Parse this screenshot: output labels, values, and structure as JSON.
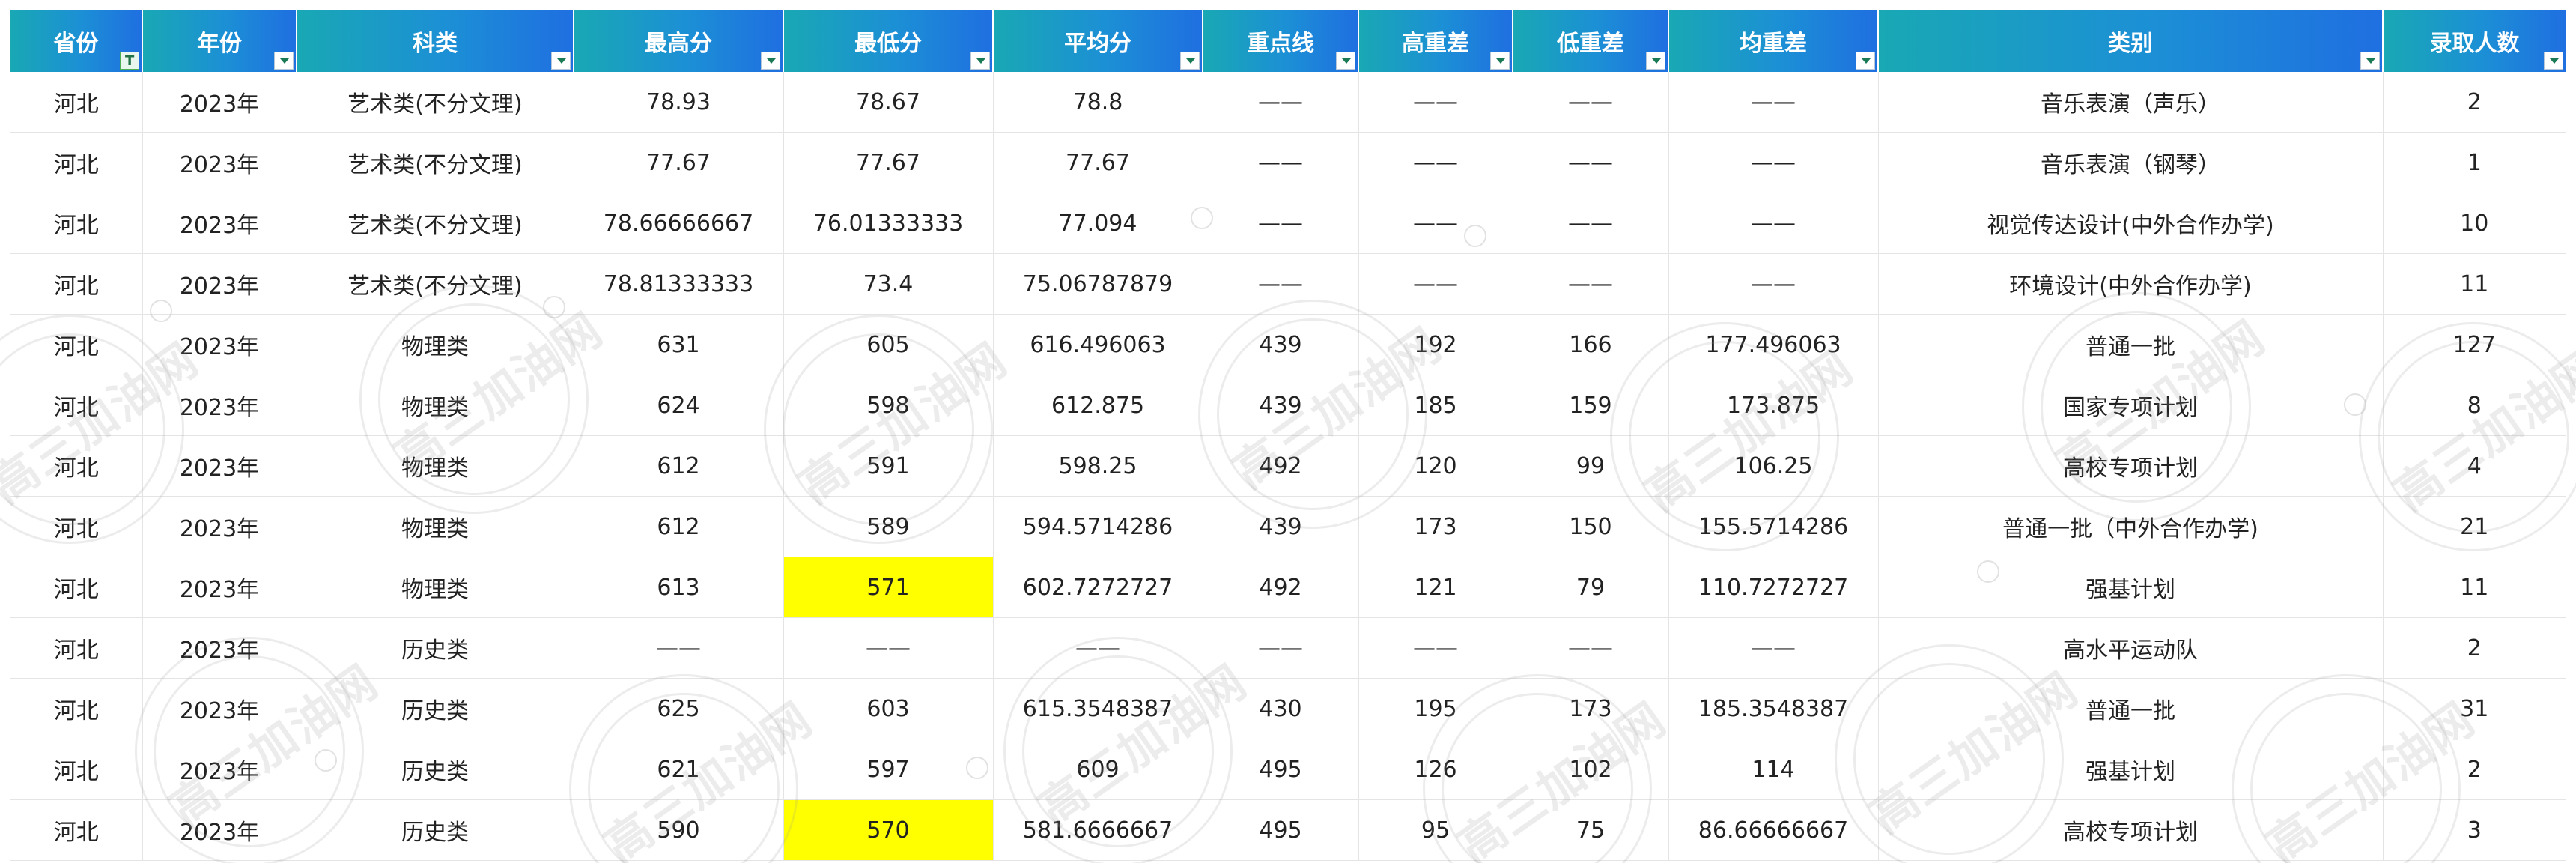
{
  "table": {
    "headers": [
      "省份",
      "年份",
      "科类",
      "最高分",
      "最低分",
      "平均分",
      "重点线",
      "高重差",
      "低重差",
      "均重差",
      "类别",
      "录取人数"
    ],
    "rows": [
      [
        "河北",
        "2023年",
        "艺术类(不分文理)",
        "78.93",
        "78.67",
        "78.8",
        "——",
        "——",
        "——",
        "——",
        "音乐表演（声乐）",
        "2"
      ],
      [
        "河北",
        "2023年",
        "艺术类(不分文理)",
        "77.67",
        "77.67",
        "77.67",
        "——",
        "——",
        "——",
        "——",
        "音乐表演（钢琴）",
        "1"
      ],
      [
        "河北",
        "2023年",
        "艺术类(不分文理)",
        "78.66666667",
        "76.01333333",
        "77.094",
        "——",
        "——",
        "——",
        "——",
        "视觉传达设计(中外合作办学)",
        "10"
      ],
      [
        "河北",
        "2023年",
        "艺术类(不分文理)",
        "78.81333333",
        "73.4",
        "75.06787879",
        "——",
        "——",
        "——",
        "——",
        "环境设计(中外合作办学)",
        "11"
      ],
      [
        "河北",
        "2023年",
        "物理类",
        "631",
        "605",
        "616.496063",
        "439",
        "192",
        "166",
        "177.496063",
        "普通一批",
        "127"
      ],
      [
        "河北",
        "2023年",
        "物理类",
        "624",
        "598",
        "612.875",
        "439",
        "185",
        "159",
        "173.875",
        "国家专项计划",
        "8"
      ],
      [
        "河北",
        "2023年",
        "物理类",
        "612",
        "591",
        "598.25",
        "492",
        "120",
        "99",
        "106.25",
        "高校专项计划",
        "4"
      ],
      [
        "河北",
        "2023年",
        "物理类",
        "612",
        "589",
        "594.5714286",
        "439",
        "173",
        "150",
        "155.5714286",
        "普通一批（中外合作办学)",
        "21"
      ],
      [
        "河北",
        "2023年",
        "物理类",
        "613",
        "571",
        "602.7272727",
        "492",
        "121",
        "79",
        "110.7272727",
        "强基计划",
        "11"
      ],
      [
        "河北",
        "2023年",
        "历史类",
        "——",
        "——",
        "——",
        "——",
        "——",
        "——",
        "——",
        "高水平运动队",
        "2"
      ],
      [
        "河北",
        "2023年",
        "历史类",
        "625",
        "603",
        "615.3548387",
        "430",
        "195",
        "173",
        "185.3548387",
        "普通一批",
        "31"
      ],
      [
        "河北",
        "2023年",
        "历史类",
        "621",
        "597",
        "609",
        "495",
        "126",
        "102",
        "114",
        "强基计划",
        "2"
      ],
      [
        "河北",
        "2023年",
        "历史类",
        "590",
        "570",
        "581.6666667",
        "495",
        "95",
        "75",
        "86.66666667",
        "高校专项计划",
        "3"
      ]
    ]
  },
  "watermark": {
    "text": "高三加油网"
  },
  "colors": {
    "header_start": "#19a8b4",
    "header_end": "#1f6fe0",
    "highlight": "#ffff00",
    "grid_line": "#e4e4e4"
  }
}
